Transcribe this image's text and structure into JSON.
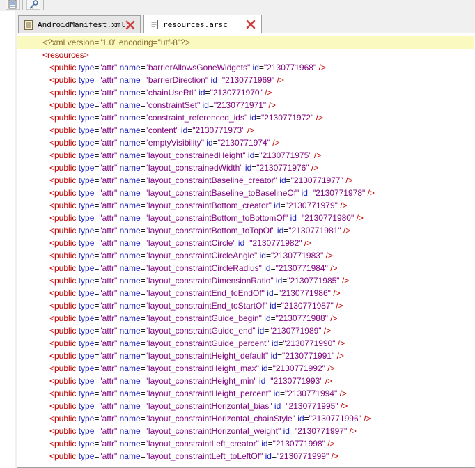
{
  "toolbar": {
    "buttons": [
      {
        "icon": "document-list-icon"
      },
      {
        "icon": "key-icon"
      }
    ]
  },
  "tabs": [
    {
      "label": "AndroidManifest.xml",
      "active": false,
      "icon": "xml-file-icon",
      "close_icon": "close-icon"
    },
    {
      "label": "resources.arsc",
      "active": true,
      "icon": "arsc-file-icon",
      "close_icon": "close-icon"
    }
  ],
  "colors": {
    "tag": "#c00000",
    "attribute": "#2020c0",
    "value": "#7f007f",
    "declaration": "#8a6a2a",
    "highlight": "#fafac0"
  },
  "editor": {
    "declaration": "<?xml version=\"1.0\" encoding=\"utf-8\"?>",
    "root_open": "<resources>",
    "entries": [
      {
        "tag": "public",
        "type": "attr",
        "name": "barrierAllowsGoneWidgets",
        "id": "2130771968"
      },
      {
        "tag": "public",
        "type": "attr",
        "name": "barrierDirection",
        "id": "2130771969"
      },
      {
        "tag": "public",
        "type": "attr",
        "name": "chainUseRtl",
        "id": "2130771970"
      },
      {
        "tag": "public",
        "type": "attr",
        "name": "constraintSet",
        "id": "2130771971"
      },
      {
        "tag": "public",
        "type": "attr",
        "name": "constraint_referenced_ids",
        "id": "2130771972"
      },
      {
        "tag": "public",
        "type": "attr",
        "name": "content",
        "id": "2130771973"
      },
      {
        "tag": "public",
        "type": "attr",
        "name": "emptyVisibility",
        "id": "2130771974"
      },
      {
        "tag": "public",
        "type": "attr",
        "name": "layout_constrainedHeight",
        "id": "2130771975"
      },
      {
        "tag": "public",
        "type": "attr",
        "name": "layout_constrainedWidth",
        "id": "2130771976"
      },
      {
        "tag": "public",
        "type": "attr",
        "name": "layout_constraintBaseline_creator",
        "id": "2130771977"
      },
      {
        "tag": "public",
        "type": "attr",
        "name": "layout_constraintBaseline_toBaselineOf",
        "id": "2130771978"
      },
      {
        "tag": "public",
        "type": "attr",
        "name": "layout_constraintBottom_creator",
        "id": "2130771979"
      },
      {
        "tag": "public",
        "type": "attr",
        "name": "layout_constraintBottom_toBottomOf",
        "id": "2130771980"
      },
      {
        "tag": "public",
        "type": "attr",
        "name": "layout_constraintBottom_toTopOf",
        "id": "2130771981"
      },
      {
        "tag": "public",
        "type": "attr",
        "name": "layout_constraintCircle",
        "id": "2130771982"
      },
      {
        "tag": "public",
        "type": "attr",
        "name": "layout_constraintCircleAngle",
        "id": "2130771983"
      },
      {
        "tag": "public",
        "type": "attr",
        "name": "layout_constraintCircleRadius",
        "id": "2130771984"
      },
      {
        "tag": "public",
        "type": "attr",
        "name": "layout_constraintDimensionRatio",
        "id": "2130771985"
      },
      {
        "tag": "public",
        "type": "attr",
        "name": "layout_constraintEnd_toEndOf",
        "id": "2130771986"
      },
      {
        "tag": "public",
        "type": "attr",
        "name": "layout_constraintEnd_toStartOf",
        "id": "2130771987"
      },
      {
        "tag": "public",
        "type": "attr",
        "name": "layout_constraintGuide_begin",
        "id": "2130771988"
      },
      {
        "tag": "public",
        "type": "attr",
        "name": "layout_constraintGuide_end",
        "id": "2130771989"
      },
      {
        "tag": "public",
        "type": "attr",
        "name": "layout_constraintGuide_percent",
        "id": "2130771990"
      },
      {
        "tag": "public",
        "type": "attr",
        "name": "layout_constraintHeight_default",
        "id": "2130771991"
      },
      {
        "tag": "public",
        "type": "attr",
        "name": "layout_constraintHeight_max",
        "id": "2130771992"
      },
      {
        "tag": "public",
        "type": "attr",
        "name": "layout_constraintHeight_min",
        "id": "2130771993"
      },
      {
        "tag": "public",
        "type": "attr",
        "name": "layout_constraintHeight_percent",
        "id": "2130771994"
      },
      {
        "tag": "public",
        "type": "attr",
        "name": "layout_constraintHorizontal_bias",
        "id": "2130771995"
      },
      {
        "tag": "public",
        "type": "attr",
        "name": "layout_constraintHorizontal_chainStyle",
        "id": "2130771996"
      },
      {
        "tag": "public",
        "type": "attr",
        "name": "layout_constraintHorizontal_weight",
        "id": "2130771997"
      },
      {
        "tag": "public",
        "type": "attr",
        "name": "layout_constraintLeft_creator",
        "id": "2130771998"
      },
      {
        "tag": "public",
        "type": "attr",
        "name": "layout_constraintLeft_toLeftOf",
        "id": "2130771999"
      }
    ]
  }
}
